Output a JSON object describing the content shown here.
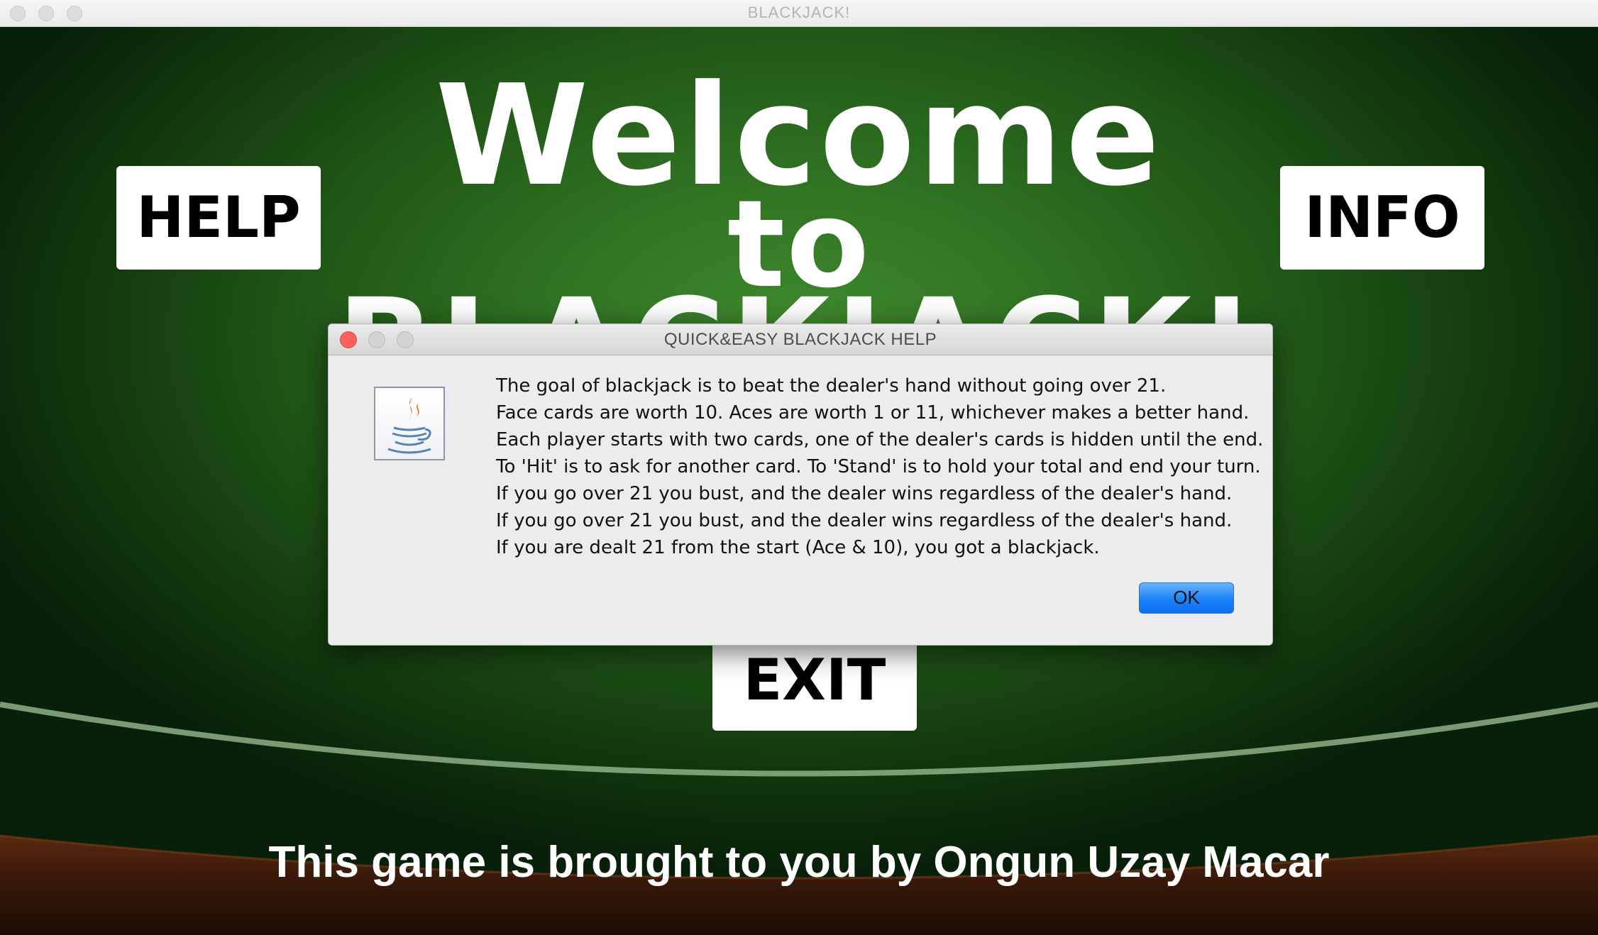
{
  "window": {
    "title": "BLACKJACK!"
  },
  "main": {
    "welcome_line1": "Welcome",
    "welcome_line2": "to",
    "welcome_line3": "BLACKJACK!",
    "help_label": "HELP",
    "info_label": "INFO",
    "exit_label": "EXIT",
    "credit": "This game is brought to you by Ongun Uzay Macar"
  },
  "dialog": {
    "title": "QUICK&EASY BLACKJACK HELP",
    "icon": "java-coffee-cup-icon",
    "lines": [
      "The goal of blackjack is to beat the dealer's hand without going over 21.",
      "Face cards are worth 10. Aces are worth 1 or 11, whichever makes a better hand.",
      "Each player starts with two cards, one of the dealer's cards is hidden until the end.",
      "To 'Hit' is to ask for another card. To 'Stand' is to hold your total and end your turn.",
      "If you go over 21 you bust, and the dealer wins regardless of the dealer's hand.",
      "If you go over 21 you bust, and the dealer wins regardless of the dealer's hand.",
      "If you are dealt 21 from the start (Ace & 10), you got a blackjack."
    ],
    "ok_label": "OK"
  },
  "colors": {
    "felt": "#2f7122",
    "ok_button": "#1a82fb",
    "close_dot": "#fc605c"
  }
}
